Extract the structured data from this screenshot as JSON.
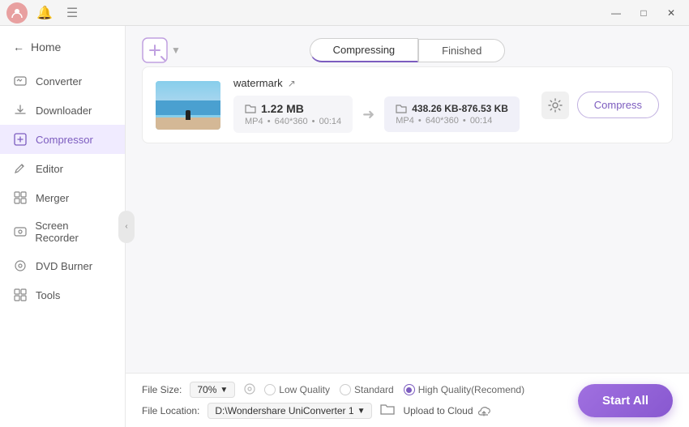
{
  "titlebar": {
    "window_controls": {
      "minimize": "—",
      "maximize": "□",
      "close": "✕"
    }
  },
  "sidebar": {
    "home_label": "Home",
    "items": [
      {
        "id": "converter",
        "label": "Converter",
        "icon": "⇄"
      },
      {
        "id": "downloader",
        "label": "Downloader",
        "icon": "↓"
      },
      {
        "id": "compressor",
        "label": "Compressor",
        "icon": "⊡",
        "active": true
      },
      {
        "id": "editor",
        "label": "Editor",
        "icon": "✂"
      },
      {
        "id": "merger",
        "label": "Merger",
        "icon": "⊞"
      },
      {
        "id": "screen-recorder",
        "label": "Screen Recorder",
        "icon": "⊙"
      },
      {
        "id": "dvd-burner",
        "label": "DVD Burner",
        "icon": "◎"
      },
      {
        "id": "tools",
        "label": "Tools",
        "icon": "⊞"
      }
    ]
  },
  "tabs": {
    "compressing": "Compressing",
    "finished": "Finished"
  },
  "file": {
    "name": "watermark",
    "original_size": "1.22 MB",
    "original_format": "MP4",
    "original_resolution": "640*360",
    "original_duration": "00:14",
    "compressed_size_range": "438.26 KB-876.53 KB",
    "compressed_format": "MP4",
    "compressed_resolution": "640*360",
    "compressed_duration": "00:14",
    "compress_btn": "Compress"
  },
  "bottom": {
    "file_size_label": "File Size:",
    "file_size_value": "70%",
    "quality_options": {
      "label": "Low Quality",
      "standard": "Standard",
      "high": "High Quality(Recomend)"
    },
    "file_location_label": "File Location:",
    "file_location_path": "D:\\Wondershare UniConverter 1",
    "upload_cloud": "Upload to Cloud",
    "start_all": "Start All"
  }
}
